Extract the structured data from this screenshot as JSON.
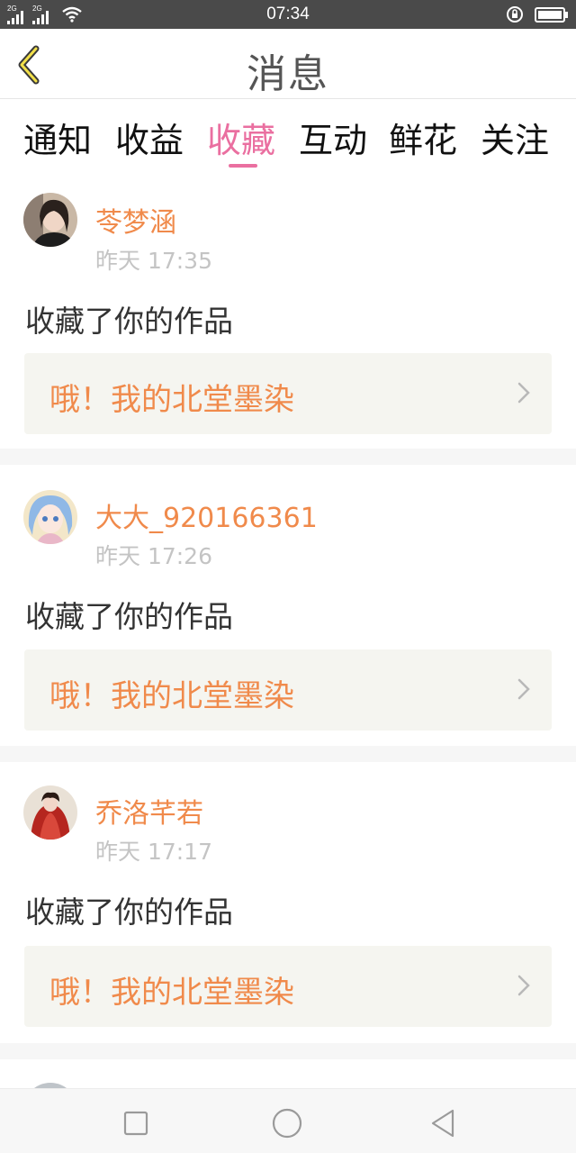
{
  "status_bar": {
    "time": "07:34",
    "network_1": "2G",
    "network_2": "2G",
    "icons": [
      "signal-icon",
      "wifi-icon",
      "rotation-lock-icon",
      "battery-icon"
    ]
  },
  "header": {
    "title": "消息",
    "back_icon": "chevron-left-icon"
  },
  "tabs": [
    {
      "label": "通知",
      "active": false
    },
    {
      "label": "收益",
      "active": false
    },
    {
      "label": "收藏",
      "active": true
    },
    {
      "label": "互动",
      "active": false
    },
    {
      "label": "鲜花",
      "active": false
    },
    {
      "label": "关注",
      "active": false
    }
  ],
  "notifications": [
    {
      "username": "苓梦涵",
      "time": "昨天 17:35",
      "action": "收藏了你的作品",
      "work_title": "哦！我的北堂墨染"
    },
    {
      "username": "大大_920166361",
      "time": "昨天 17:26",
      "action": "收藏了你的作品",
      "work_title": "哦！我的北堂墨染"
    },
    {
      "username": "乔洛芊若",
      "time": "昨天 17:17",
      "action": "收藏了你的作品",
      "work_title": "哦！我的北堂墨染"
    }
  ],
  "nav_bar": {
    "icons": [
      "recent-apps-icon",
      "home-icon",
      "back-triangle-icon"
    ]
  },
  "colors": {
    "accent_pink": "#ea6fa0",
    "username_orange": "#f08a4b",
    "status_bar": "#4a4a4a"
  }
}
